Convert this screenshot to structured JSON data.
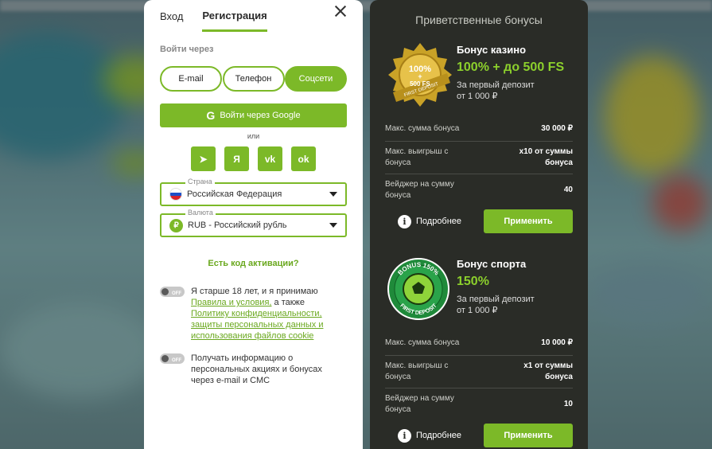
{
  "colors": {
    "accent": "#7cb928",
    "dark_panel": "#2a2c27",
    "bonus_green": "#8cd02c"
  },
  "tabs": {
    "login": "Вход",
    "register": "Регистрация"
  },
  "register": {
    "login_via": "Войти через",
    "methods": [
      "E-mail",
      "Телефон",
      "Соцсети"
    ],
    "google": "Войти через Google",
    "or": "или",
    "socials": [
      "telegram-icon",
      "yandex-icon",
      "vk-icon",
      "odnoklassniki-icon"
    ],
    "social_glyphs": [
      "➤",
      "Я",
      "vk",
      "ok"
    ],
    "country_label": "Страна",
    "country_value": "Российская Федерация",
    "currency_label": "Валюта",
    "currency_value": "RUB - Российский рубль",
    "currency_symbol": "₽",
    "promo": "Есть код активации?",
    "toggle_off": "OFF",
    "agree_text": "Я старше 18 лет, и я принимаю",
    "agree_link1": "Правила и условия,",
    "agree_mid": " а также",
    "agree_link2": "Политику конфиденциальности, защиты персональных данных и использования файлов cookie",
    "news_text": "Получать информацию о персональных акциях и бонусах через e-mail и СМС"
  },
  "bonus": {
    "heading": "Приветственные бонусы",
    "casino": {
      "badge_line1": "100%",
      "badge_line2": "+",
      "badge_line3": "500 FS",
      "badge_ribbon": "FIRST DEPOSIT",
      "name": "Бонус казино",
      "amount": "100% + до 500 FS",
      "cond1": "За первый депозит",
      "cond2": "от 1 000 ₽",
      "rows": [
        {
          "k": "Макс. сумма бонуса",
          "v": "30 000 ₽"
        },
        {
          "k": "Макс. выигрыш с бонуса",
          "v": "x10 от суммы бонуса"
        },
        {
          "k": "Вейджер на сумму бонуса",
          "v": "40"
        }
      ],
      "more": "Подробнее",
      "apply": "Применить"
    },
    "sport": {
      "badge_top": "BONUS 150%",
      "badge_bottom": "FIRST DEPOSIT",
      "name": "Бонус спорта",
      "amount": "150%",
      "cond1": "За первый депозит",
      "cond2": "от 1 000 ₽",
      "rows": [
        {
          "k": "Макс. сумма бонуса",
          "v": "10 000 ₽"
        },
        {
          "k": "Макс. выигрыш с бонуса",
          "v": "x1 от суммы бонуса"
        },
        {
          "k": "Вейджер на сумму бонуса",
          "v": "10"
        }
      ],
      "more": "Подробнее",
      "apply": "Применить"
    }
  }
}
